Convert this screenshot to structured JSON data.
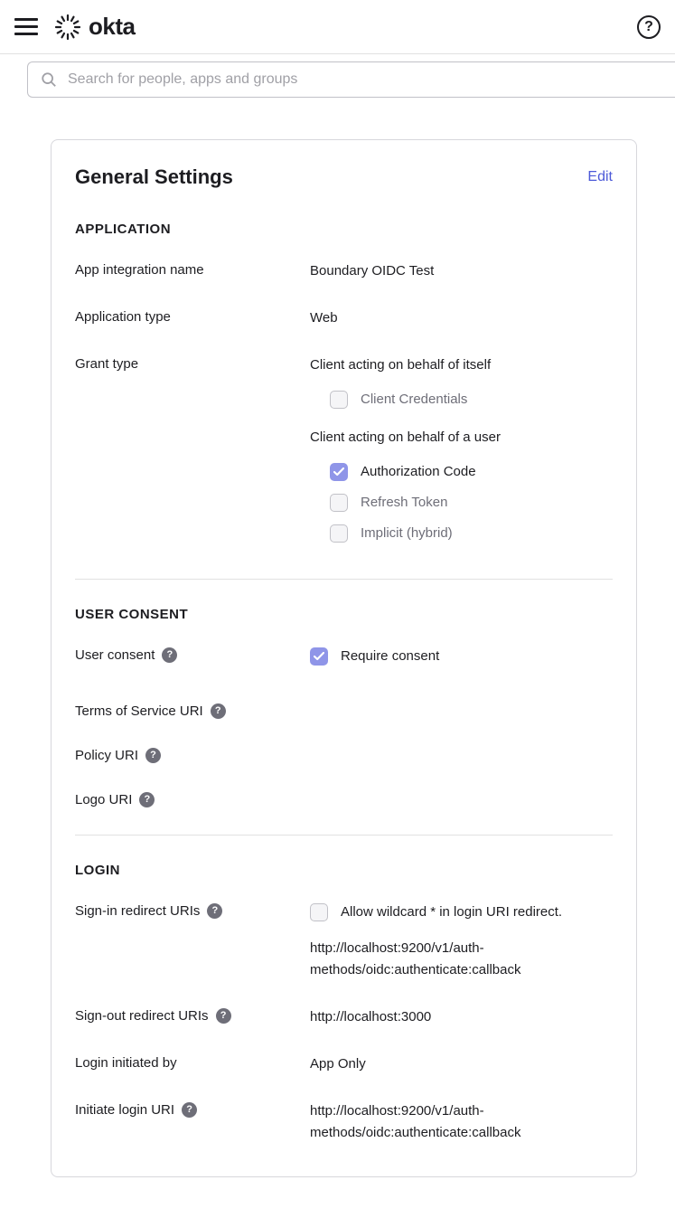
{
  "brand": "okta",
  "search": {
    "placeholder": "Search for people, apps and groups"
  },
  "card": {
    "title": "General Settings",
    "edit": "Edit",
    "sections": {
      "application": {
        "heading": "APPLICATION",
        "app_name_label": "App integration name",
        "app_name_value": "Boundary OIDC Test",
        "app_type_label": "Application type",
        "app_type_value": "Web",
        "grant_type_label": "Grant type",
        "grant_self_heading": "Client acting on behalf of itself",
        "grant_self_items": [
          {
            "label": "Client Credentials",
            "checked": false
          }
        ],
        "grant_user_heading": "Client acting on behalf of a user",
        "grant_user_items": [
          {
            "label": "Authorization Code",
            "checked": true
          },
          {
            "label": "Refresh Token",
            "checked": false
          },
          {
            "label": "Implicit (hybrid)",
            "checked": false
          }
        ]
      },
      "consent": {
        "heading": "USER CONSENT",
        "user_consent_label": "User consent",
        "require_consent_label": "Require consent",
        "require_consent_checked": true,
        "tos_label": "Terms of Service URI",
        "policy_label": "Policy URI",
        "logo_label": "Logo URI"
      },
      "login": {
        "heading": "LOGIN",
        "signin_label": "Sign-in redirect URIs",
        "wildcard_label": "Allow wildcard * in login URI redirect.",
        "wildcard_checked": false,
        "signin_value": "http://localhost:9200/v1/auth-methods/oidc:authenticate:callback",
        "signout_label": "Sign-out redirect URIs",
        "signout_value": "http://localhost:3000",
        "initiated_by_label": "Login initiated by",
        "initiated_by_value": "App Only",
        "initiate_uri_label": "Initiate login URI",
        "initiate_uri_value": "http://localhost:9200/v1/auth-methods/oidc:authenticate:callback"
      }
    }
  }
}
